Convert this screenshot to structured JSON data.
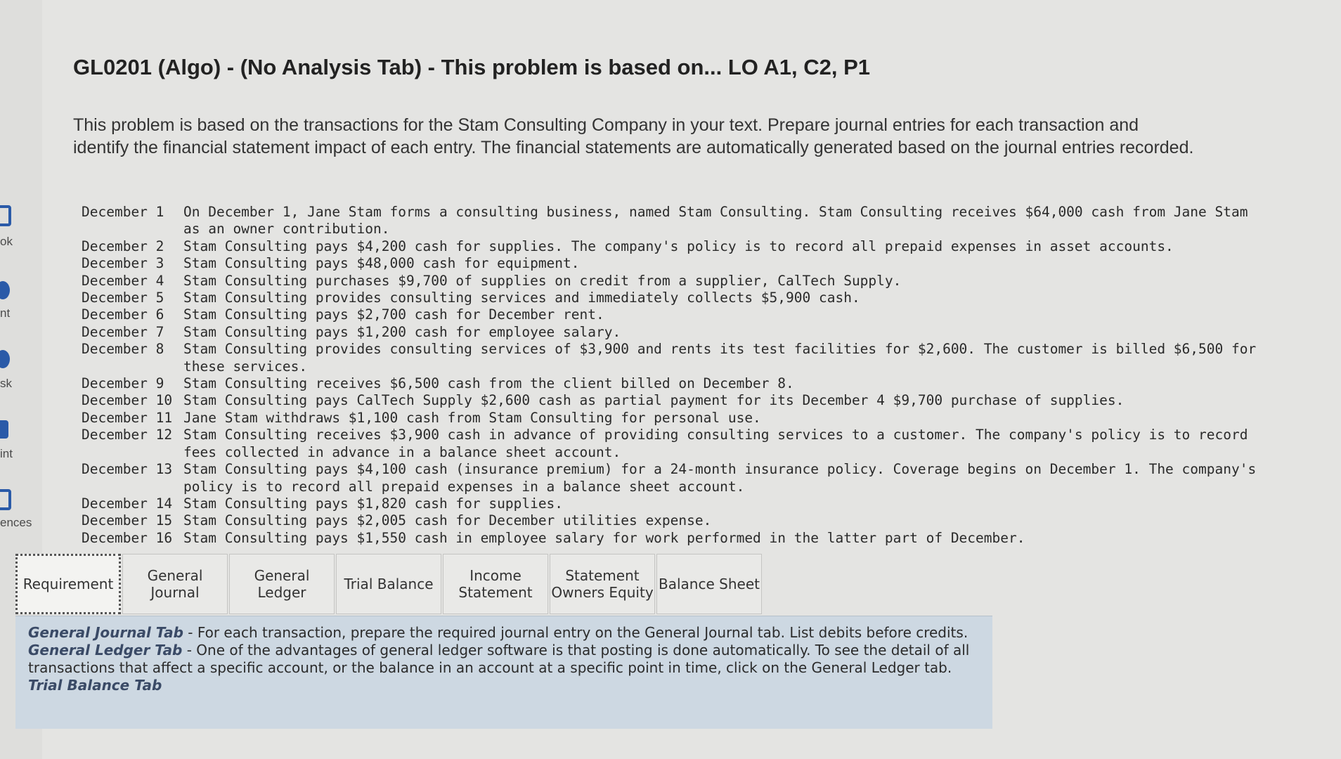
{
  "sidebar": {
    "items": [
      "ok",
      "nt",
      "sk",
      "int",
      "ences"
    ]
  },
  "problem": {
    "title": "GL0201 (Algo) - (No Analysis Tab) - This problem is based on... LO A1, C2, P1",
    "intro": "This problem is based on the transactions for the Stam Consulting Company in your text. Prepare journal entries for each transaction and identify the financial statement impact of each entry. The financial statements are automatically generated based on the journal entries recorded."
  },
  "transactions": [
    {
      "date": "December 1",
      "text": "On December 1, Jane Stam forms a consulting business, named Stam Consulting. Stam Consulting receives $64,000 cash from Jane Stam as an owner contribution."
    },
    {
      "date": "December 2",
      "text": "Stam Consulting pays $4,200 cash for supplies. The company's policy is to record all prepaid expenses in asset accounts."
    },
    {
      "date": "December 3",
      "text": "Stam Consulting pays $48,000 cash for equipment."
    },
    {
      "date": "December 4",
      "text": "Stam Consulting purchases $9,700 of supplies on credit from a supplier, CalTech Supply."
    },
    {
      "date": "December 5",
      "text": "Stam Consulting provides consulting services and immediately collects $5,900 cash."
    },
    {
      "date": "December 6",
      "text": "Stam Consulting pays $2,700 cash for December rent."
    },
    {
      "date": "December 7",
      "text": "Stam Consulting pays $1,200 cash for employee salary."
    },
    {
      "date": "December 8",
      "text": "Stam Consulting provides consulting services of $3,900 and rents its test facilities for $2,600. The customer is billed $6,500 for these services."
    },
    {
      "date": "December 9",
      "text": "Stam Consulting receives $6,500 cash from the client billed on December 8."
    },
    {
      "date": "December 10",
      "text": "Stam Consulting pays CalTech Supply $2,600 cash as partial payment for its December 4 $9,700 purchase of supplies."
    },
    {
      "date": "December 11",
      "text": "Jane Stam withdraws $1,100 cash from Stam Consulting for personal use."
    },
    {
      "date": "December 12",
      "text": "Stam Consulting receives $3,900 cash in advance of providing consulting services to a customer. The company's policy is to record fees collected in advance in a balance sheet account."
    },
    {
      "date": "December 13",
      "text": "Stam Consulting pays $4,100 cash (insurance premium) for a 24-month insurance policy. Coverage begins on December 1. The company's policy is to record all prepaid expenses in a balance sheet account."
    },
    {
      "date": "December 14",
      "text": "Stam Consulting pays $1,820 cash for supplies."
    },
    {
      "date": "December 15",
      "text": "Stam Consulting pays $2,005 cash for December utilities expense."
    },
    {
      "date": "December 16",
      "text": "Stam Consulting pays $1,550 cash in employee salary for work performed in the latter part of December."
    }
  ],
  "tabs": [
    {
      "label": "Requirement",
      "active": true
    },
    {
      "label": "General\nJournal",
      "active": false
    },
    {
      "label": "General\nLedger",
      "active": false
    },
    {
      "label": "Trial Balance",
      "active": false
    },
    {
      "label": "Income\nStatement",
      "active": false
    },
    {
      "label": "Statement\nOwners Equity",
      "active": false
    },
    {
      "label": "Balance Sheet",
      "active": false
    }
  ],
  "instructions": [
    {
      "heading": "General Journal Tab",
      "text": " - For each transaction, prepare the required journal entry on the General Journal tab. List debits before credits."
    },
    {
      "heading": "General Ledger Tab",
      "text": " - One of the advantages of general ledger software is that posting is done automatically. To see the detail of all transactions that affect a specific account, or the balance in an account at a specific point in time, click on the General Ledger tab."
    },
    {
      "heading": "Trial Balance Tab",
      "text": ""
    }
  ]
}
